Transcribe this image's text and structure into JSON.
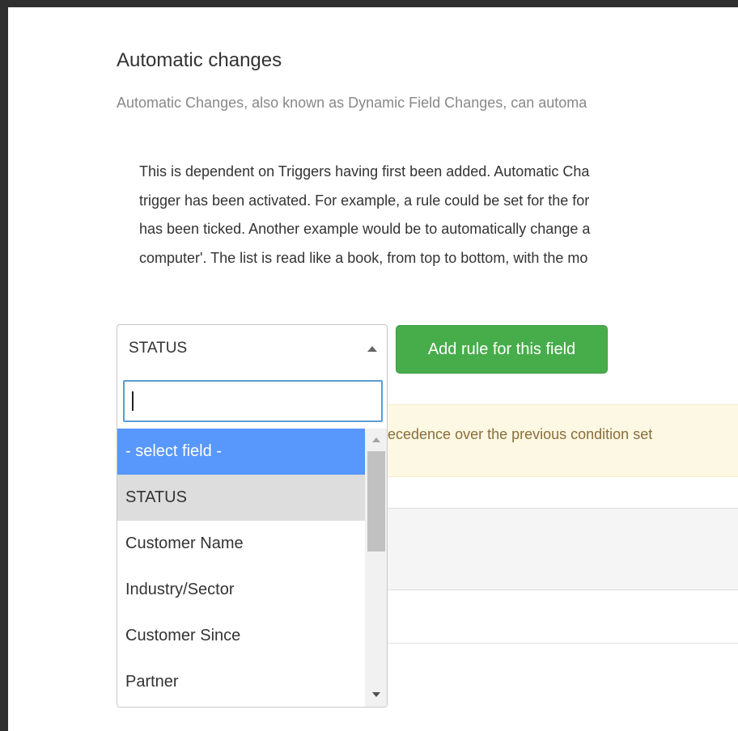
{
  "header": {
    "title": "Automatic changes",
    "subtitle": "Automatic Changes, also known as Dynamic Field Changes, can automa"
  },
  "description": {
    "lines": [
      "This is dependent on Triggers having first been added. Automatic Cha",
      "trigger has been activated. For example, a rule could be set for the for",
      "has been ticked. Another example would be to automatically change a",
      "computer'. The list is read like a book, from top to bottom, with the mo"
    ]
  },
  "field_select": {
    "value": "STATUS",
    "search_value": "",
    "options": [
      "- select field -",
      "STATUS",
      "Customer Name",
      "Industry/Sector",
      "Customer Since",
      "Partner"
    ],
    "highlighted_index": 0,
    "selected_index": 1
  },
  "add_rule_button": {
    "label": "Add rule for this field"
  },
  "alert": {
    "text": "ecedence over the previous condition set"
  },
  "colors": {
    "add_button_bg": "#47ad4b",
    "highlight_bg": "#5897fb",
    "selected_bg": "#dddddd",
    "alert_bg": "#fcf8e3",
    "alert_text": "#8a6d3b"
  }
}
